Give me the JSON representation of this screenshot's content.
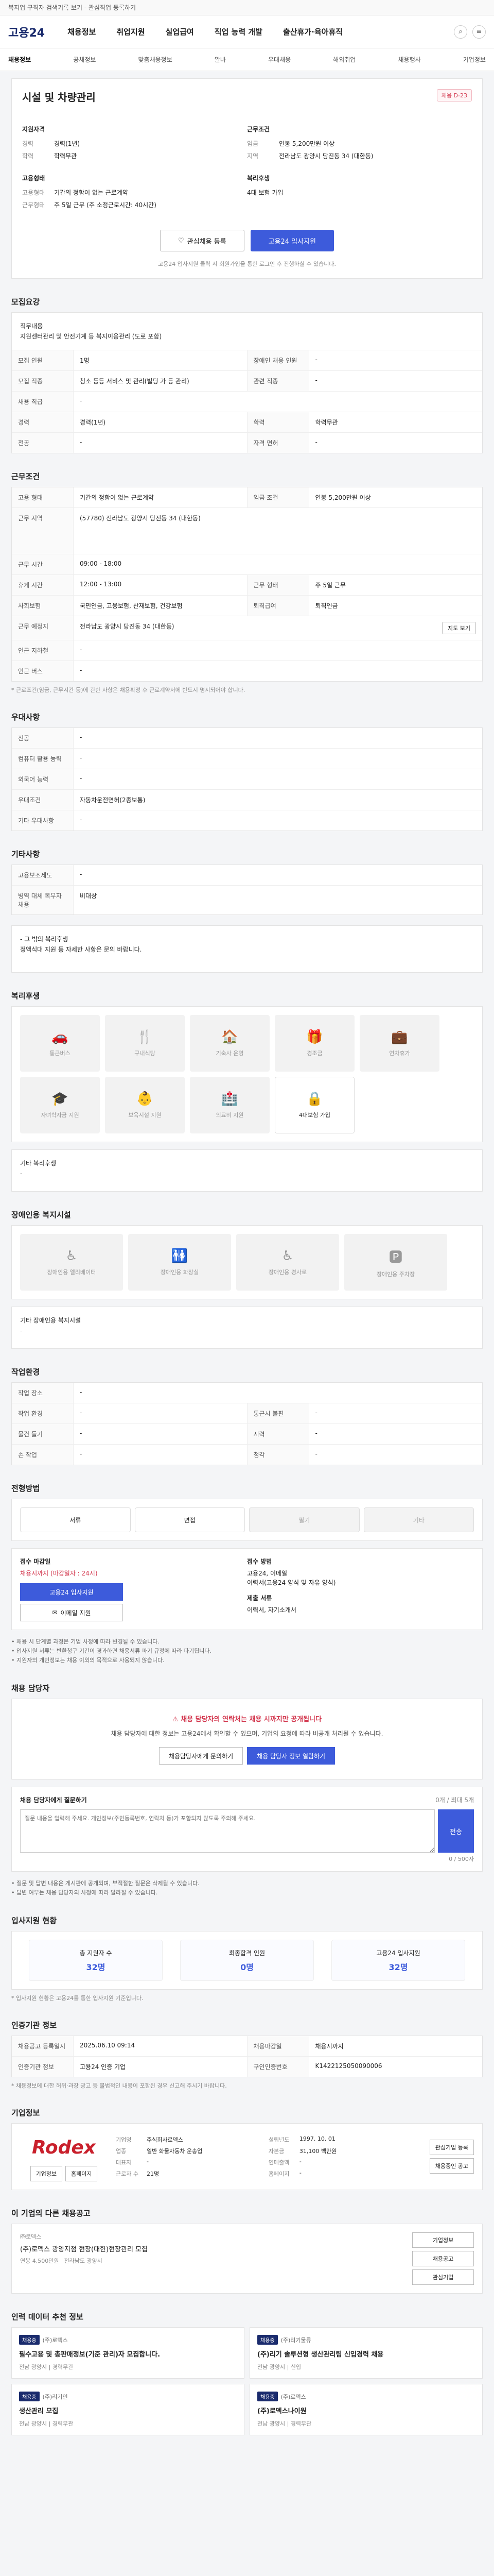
{
  "banner": "복지업 구직자 검색기록 보기 - 관심직업 등록하기",
  "header": {
    "logo": "고용24",
    "menu": [
      "채용정보",
      "취업지원",
      "실업급여",
      "직업 능력 개발",
      "출산휴가·육아휴직"
    ],
    "icons": [
      "search-icon",
      "menu-icon"
    ]
  },
  "subnav": {
    "items": [
      "채용정보",
      "공채정보",
      "맞춤채용정보",
      "알바",
      "우대채용",
      "해외취업",
      "채용행사",
      "기업정보"
    ],
    "active": 0
  },
  "job": {
    "title": "시설 및 차량관리",
    "badge": "채용 D-23",
    "qualifications": {
      "heading": "지원자격",
      "rows": [
        {
          "k": "경력",
          "v": "경력(1년)"
        },
        {
          "k": "학력",
          "v": "학력무관"
        }
      ]
    },
    "conditions": {
      "heading": "근무조건",
      "rows": [
        {
          "k": "임금",
          "v": "연봉 5,200만원 이상"
        },
        {
          "k": "지역",
          "v": "전라남도 광양시 당진동 34 (대한동)"
        }
      ]
    },
    "empType": {
      "heading": "고용형태",
      "rows": [
        {
          "k": "고용형태",
          "v": "기간의 정함이 없는 근로계약"
        },
        {
          "k": "근무형태",
          "v": "주 5일 근무 (주 소정근로시간: 40시간)"
        }
      ]
    },
    "welfareHead": {
      "heading": "복리후생",
      "rows": [
        {
          "k": "",
          "v": "4대 보험 가입"
        }
      ]
    },
    "scrap_btn": "관심채용 등록",
    "apply_btn": "고용24 입사지원",
    "note": "고용24 입사지원 클릭 시 회원가입을 통한 로그인 후 진행하실 수 있습니다."
  },
  "sections": {
    "recruit": "모집요강",
    "work": "근무조건",
    "pref": "우대사항",
    "other": "기타사항",
    "welfare": "복리후생",
    "disabled": "장애인용 복지시설",
    "env": "작업환경",
    "proc": "전형방법",
    "contact": "채용 담당자",
    "stats": "입사지원 현황",
    "info": "인증기관 정보",
    "corp": "기업정보",
    "more": "인력 데이터 추천 정보"
  },
  "recruit": {
    "duty": {
      "k": "직무내용",
      "lines": [
        "직무내용",
        "지원센터관리 및 안전기계 등 복지이용관리 (도로 포함)"
      ]
    },
    "rows": [
      [
        {
          "k": "모집 인원",
          "v": "1명"
        },
        {
          "k": "장애인 채용 인원",
          "v": "-"
        }
      ],
      [
        {
          "k": "모집 직종",
          "v": "청소 등등 서비스 및 관리(빌딩 가 등 관리)"
        },
        {
          "k": "관련 직종",
          "v": "-"
        }
      ],
      [
        {
          "k": "채용 직급",
          "v": "-"
        }
      ],
      [
        {
          "k": "경력",
          "v": "경력(1년)"
        },
        {
          "k": "학력",
          "v": "학력무관"
        }
      ],
      [
        {
          "k": "전공",
          "v": "-"
        },
        {
          "k": "자격 면허",
          "v": "-"
        }
      ]
    ]
  },
  "work": {
    "rows": [
      [
        {
          "k": "고용 형태",
          "v": "기간의 정함이 없는 근로계약"
        },
        {
          "k": "임금 조건",
          "v": "연봉 5,200만원 이상"
        }
      ],
      [
        {
          "k": "근무 지역",
          "v": "(57780) 전라남도 광양시 당진동 34 (대한동)"
        }
      ]
    ],
    "hours": {
      "k": "근무 시간",
      "v": "09:00 - 18:00"
    },
    "breakRow": [
      {
        "k": "휴게 시간",
        "v": "12:00 - 13:00"
      },
      {
        "k": "근무 형태",
        "v": "주 5일 근무"
      }
    ],
    "insRow": [
      {
        "k": "사회보험",
        "v": "국민연금, 고용보험, 산재보험, 건강보험"
      },
      {
        "k": "퇴직급여",
        "v": "퇴직연금"
      }
    ],
    "subway": {
      "k": "인근 지하철",
      "v": "-"
    },
    "bus": {
      "k": "인근 버스",
      "v": "-"
    },
    "place": {
      "k": "근무 예정지",
      "v": "전라남도 광양시 당진동 34 (대한동)"
    },
    "map_btn": "지도 보기",
    "tip": "* 근로조건(임금, 근무시간 등)에 관한 사항은 채용확정 후 근로계약서에 반드시 명시되어야 합니다."
  },
  "pref": {
    "rows": [
      {
        "k": "전공",
        "v": "-"
      },
      {
        "k": "컴퓨터 활용 능력",
        "v": "-"
      },
      {
        "k": "외국어 능력",
        "v": "-"
      },
      {
        "k": "우대조건",
        "v": "자동차운전면허(2종보통)"
      },
      {
        "k": "기타 우대사항",
        "v": "-"
      }
    ]
  },
  "other": {
    "rows": [
      {
        "k": "고용보조제도",
        "v": "-"
      },
      {
        "k": "병역 대체 복무자 채용",
        "v": "비대상"
      }
    ]
  },
  "welfareText": "- 그 밖의 복리후생\n  정액식대 지원 등 자세한 사항은 문의 바랍니다.",
  "welfare": {
    "icons": [
      {
        "name": "car-icon",
        "glyph": "🚗",
        "label": "통근버스",
        "on": false
      },
      {
        "name": "meal-icon",
        "glyph": "🍴",
        "label": "구내식당",
        "on": false
      },
      {
        "name": "home-icon",
        "glyph": "🏠",
        "label": "기숙사 운영",
        "on": false
      },
      {
        "name": "gift-icon",
        "glyph": "🎁",
        "label": "경조금",
        "on": false
      },
      {
        "name": "briefcase-icon",
        "glyph": "💼",
        "label": "연차휴가",
        "on": false
      },
      {
        "name": "graduation-icon",
        "glyph": "🎓",
        "label": "자녀학자금 지원",
        "on": false
      },
      {
        "name": "baby-icon",
        "glyph": "👶",
        "label": "보육시설 지원",
        "on": false
      },
      {
        "name": "medical-icon",
        "glyph": "🏥",
        "label": "의료비 지원",
        "on": false
      },
      {
        "name": "ins-icon",
        "glyph": "🔒",
        "label": "4대보험 가입",
        "on": true
      }
    ],
    "etc": {
      "k": "기타 복리후생",
      "v": "-"
    }
  },
  "disabled": {
    "icons": [
      {
        "name": "wheelchair-icon",
        "glyph": "♿",
        "label": "장애인용 엘리베이터"
      },
      {
        "name": "toilet-icon",
        "glyph": "🚻",
        "label": "장애인용 화장실"
      },
      {
        "name": "ramp-icon",
        "glyph": "♿",
        "label": "장애인용 경사로"
      },
      {
        "name": "parking-icon",
        "glyph": "🅿",
        "label": "장애인용 주차장"
      }
    ],
    "etc": {
      "k": "기타 장애인용 복지시설",
      "v": "-"
    }
  },
  "env": {
    "first": {
      "k": "작업 장소",
      "v": "-"
    },
    "rows": [
      [
        {
          "k": "작업 환경",
          "v": "-"
        },
        {
          "k": "통근시 불편",
          "v": "-"
        }
      ],
      [
        {
          "k": "물건 들기",
          "v": "-"
        },
        {
          "k": "시력",
          "v": "-"
        }
      ],
      [
        {
          "k": "손 작업",
          "v": "-"
        },
        {
          "k": "청각",
          "v": "-"
        }
      ]
    ]
  },
  "proc": {
    "steps": [
      {
        "label": "서류",
        "off": false
      },
      {
        "label": "면접",
        "off": false
      },
      {
        "label": "필기",
        "off": true
      },
      {
        "label": "기타",
        "off": true
      }
    ],
    "applyHead": "접수 마감일",
    "deadline": "채용시까지 (마감일자 : 24시)",
    "applyBtn1": "고용24 입사지원",
    "applyBtn2": "이메일 지원",
    "doc": {
      "k": "접수 방법",
      "v": [
        "고용24, 이메일",
        "이력서(고용24 양식 및 자유 양식)"
      ]
    },
    "count": {
      "k": "제출 서류",
      "v": "이력서, 자기소개서"
    },
    "bullets": [
      "• 채용 시 단계별 과정은 기업 사정에 따라 변경될 수 있습니다.",
      "• 입사지원 서류는 반환청구 기간이 경과하면 채용서류 파기 규정에 따라 파기됩니다.",
      "• 지원자의 개인정보는 채용 이외의 목적으로 사용되지 않습니다."
    ]
  },
  "contact": {
    "warn": "채용 담당자의 연락처는 채용 시까지만 공개됩니다",
    "body": "채용 담당자에 대한 정보는 고용24에서 확인할 수 있으며, 기업의 요청에 따라 비공개 처리될 수 있습니다.",
    "btn1": "채용담당자에게 문의하기",
    "btn2": "채용 담당자 정보 열람하기",
    "qtitle": "채용 담당자에게 질문하기",
    "qmeta": "0개 / 최대 5개",
    "placeholder": "질문 내용을 입력해 주세요. 개인정보(주민등록번호, 연락처 등)가 포함되지 않도록 주의해 주세요.",
    "send": "전송",
    "count": "0 / 500자",
    "bullets": [
      "• 질문 및 답변 내용은 게시판에 공개되며, 부적절한 질문은 삭제될 수 있습니다.",
      "• 답변 여부는 채용 담당자의 사정에 따라 달라질 수 있습니다."
    ]
  },
  "stats": {
    "items": [
      {
        "k": "총 지원자 수",
        "v": "32명"
      },
      {
        "k": "최종합격 인원",
        "v": "0명"
      },
      {
        "k": "고용24 입사지원",
        "v": "32명"
      }
    ],
    "tip": "* 입사지원 현황은 고용24를 통한 입사지원 기준입니다."
  },
  "info": {
    "rows": [
      [
        {
          "k": "채용공고 등록일시",
          "v": "2025.06.10 09:14"
        },
        {
          "k": "채용마감일",
          "v": "채용시까지"
        }
      ],
      [
        {
          "k": "인증기관 정보",
          "v": "고용24 인증 기업"
        },
        {
          "k": "구인인증번호",
          "v": "K1422125050090006"
        }
      ]
    ],
    "tip": "* 채용정보에 대한 허위·과장 광고 등 불법적인 내용이 포함된 경우 신고해 주시기 바랍니다."
  },
  "corp": {
    "logo": "Rodex",
    "rows": [
      {
        "k": "기업명",
        "v": "주식회사로덱스"
      },
      {
        "k": "업종",
        "v": "일반 화물자동차 운송업"
      },
      {
        "k": "대표자",
        "v": "-"
      },
      {
        "k": "근로자 수",
        "v": "21명"
      },
      {
        "k": "설립년도",
        "v": "1997. 10. 01"
      },
      {
        "k": "자본금",
        "v": "31,100 백만원"
      },
      {
        "k": "연매출액",
        "v": "-"
      },
      {
        "k": "홈페이지",
        "v": "-"
      }
    ],
    "btns": [
      "관심기업 등록",
      "채용중인 공고"
    ],
    "pills": [
      "기업정보",
      "홈페이지"
    ]
  },
  "more": {
    "heading": "이 기업의 다른 채용공고",
    "company": "㈜로덱스",
    "title": "(주)로덱스 광양지점 현장(대한)현장관리 모집",
    "meta": [
      "연봉 4,500만원",
      "전라남도 광양시"
    ],
    "right": [
      "기업정보",
      "채용공고",
      "관심기업"
    ],
    "recommend": "이 회사의 다른 채용",
    "cards": [
      {
        "tag": "채용중",
        "co": "(주)로덱스",
        "tt": "필수고용 및 총판매정보(기준 관리)자 모집합니다.",
        "mt": "전남 광양시 | 경력무관"
      },
      {
        "tag": "채용중",
        "co": "(주)리기물류",
        "tt": "(주)리기 솔루션형 생산관리팀 신입경력 채용",
        "mt": "전남 광양시 | 신입"
      },
      {
        "tag": "채용중",
        "co": "(주)리기인",
        "tt": "생산관리 모집",
        "mt": "전남 광양시 | 경력무관"
      },
      {
        "tag": "채용중",
        "co": "(주)로덱스",
        "tt": "(주)로덱스나이원",
        "mt": "전남 광양시 | 경력무관"
      }
    ]
  }
}
